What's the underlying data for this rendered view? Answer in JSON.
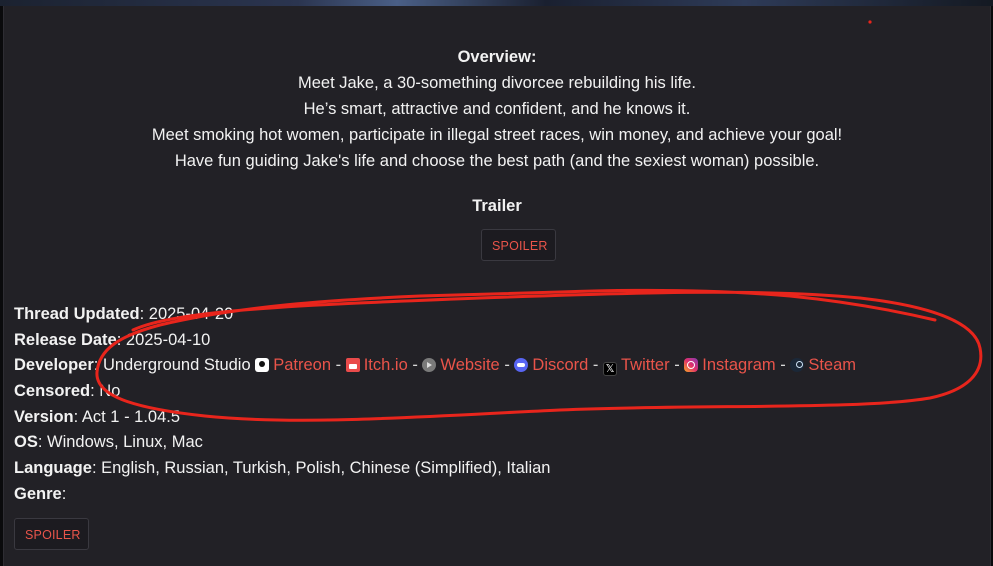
{
  "overview": {
    "title": "Overview:",
    "lines": [
      "Meet Jake, a 30-something divorcee rebuilding his life.",
      "He’s smart, attractive and confident, and he knows it.",
      "Meet smoking hot women, participate in illegal street races, win money, and achieve your goal!",
      "Have fun guiding Jake's life and choose the best path (and the sexiest woman) possible."
    ]
  },
  "trailer": {
    "title": "Trailer",
    "spoiler_label": "SPOILER"
  },
  "info": {
    "thread_updated": {
      "label": "Thread Updated",
      "value": ": 2025-04-20"
    },
    "release_date": {
      "label": "Release Date",
      "value": ": 2025-04-10"
    },
    "developer": {
      "label": "Developer",
      "name": ": Underground Studio",
      "separator": " - ",
      "links": [
        {
          "text": "Patreon",
          "icon": "patreon-icon"
        },
        {
          "text": "Itch.io",
          "icon": "itch-io-icon"
        },
        {
          "text": "Website",
          "icon": "website-icon"
        },
        {
          "text": "Discord",
          "icon": "discord-icon"
        },
        {
          "text": "Twitter",
          "icon": "x-twitter-icon"
        },
        {
          "text": "Instagram",
          "icon": "instagram-icon"
        },
        {
          "text": "Steam",
          "icon": "steam-icon"
        }
      ]
    },
    "censored": {
      "label": "Censored",
      "value": ": No"
    },
    "version": {
      "label": "Version",
      "value": ": Act 1 - 1.04.5"
    },
    "os": {
      "label": "OS",
      "value": ": Windows, Linux, Mac"
    },
    "language": {
      "label": "Language",
      "value": ": English, Russian, Turkish, Polish, Chinese (Simplified), Italian"
    },
    "genre": {
      "label": "Genre",
      "value": ":"
    }
  },
  "genre_spoiler_label": "SPOILER",
  "colors": {
    "background": "#222126",
    "link": "#e9544a",
    "annotation": "#e8251c"
  }
}
